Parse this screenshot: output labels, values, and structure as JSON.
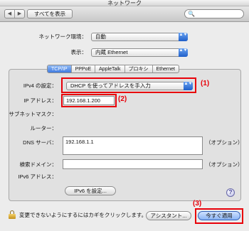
{
  "window": {
    "title": "ネットワーク"
  },
  "toolbar": {
    "back_glyph": "◀",
    "forward_glyph": "▶",
    "show_all_label": "すべてを表示",
    "search_icon": "search-icon",
    "search_glyph": "🔍"
  },
  "location": {
    "label": "ネットワーク環境：",
    "value": "自動"
  },
  "show": {
    "label": "表示：",
    "value": "内蔵 Ethernet"
  },
  "popup_arrows": "▲▼",
  "tabs": [
    {
      "label": "TCP/IP",
      "active": true
    },
    {
      "label": "PPPoE",
      "active": false
    },
    {
      "label": "AppleTalk",
      "active": false
    },
    {
      "label": "プロキシ",
      "active": false
    },
    {
      "label": "Ethernet",
      "active": false
    }
  ],
  "ipv4": {
    "label": "IPv4 の設定：",
    "value": "DHCP を使ってアドレスを手入力",
    "annotation": "(1)"
  },
  "ip": {
    "label": "IP アドレス：",
    "value": "192.168.1.200",
    "annotation": "(2)"
  },
  "subnet": {
    "label": "サブネットマスク："
  },
  "router": {
    "label": "ルーター："
  },
  "dns": {
    "label": "DNS サーバ：",
    "value": "192.168.1.1",
    "optional": "（オプション）"
  },
  "search_domain": {
    "label": "検索ドメイン：",
    "value": "",
    "optional": "（オプション）"
  },
  "ipv6": {
    "label": "IPv6 アドレス：",
    "button": "IPv6 を設定..."
  },
  "help_glyph": "?",
  "footer": {
    "lock_text": "変更できないようにするにはカギをクリックします。",
    "assistant_button": "アシスタント...",
    "apply_button": "今すぐ適用",
    "apply_annotation": "(3)"
  },
  "colors": {
    "annotation_red": "#e8000a",
    "accent_blue": "#3f7be0"
  }
}
